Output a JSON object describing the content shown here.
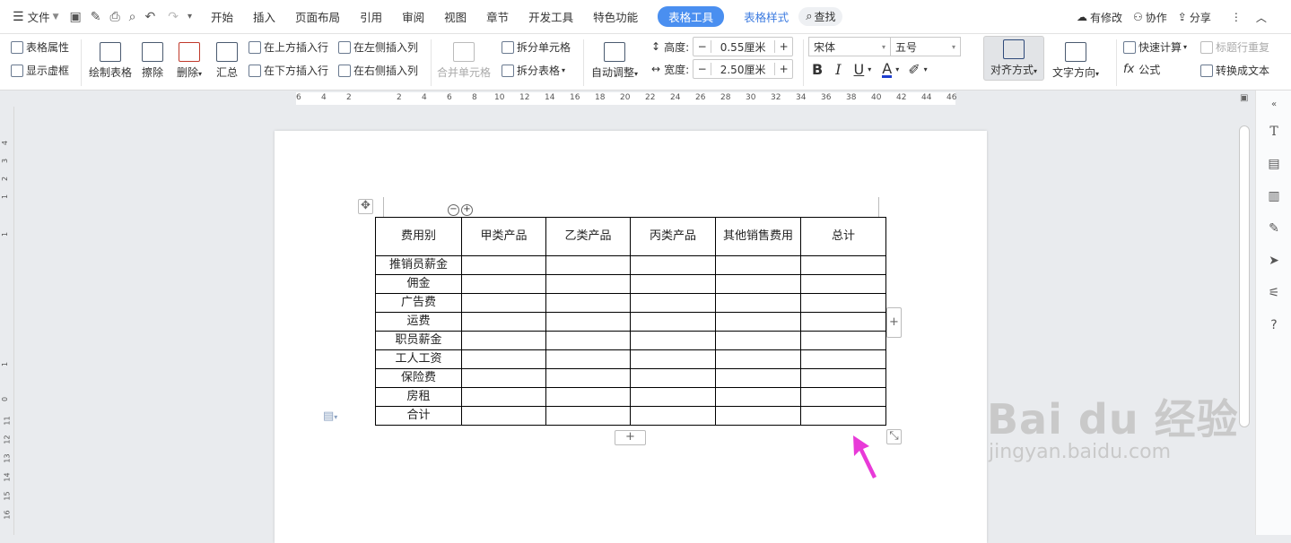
{
  "menubar": {
    "file": "文件",
    "tabs": [
      "开始",
      "插入",
      "页面布局",
      "引用",
      "审阅",
      "视图",
      "章节",
      "开发工具",
      "特色功能"
    ],
    "active_tab": "表格工具",
    "style_tab": "表格样式",
    "search": "查找",
    "has_changes": "有修改",
    "collab": "协作",
    "share": "分享"
  },
  "ribbon": {
    "table_props": "表格属性",
    "show_grid": "显示虚框",
    "draw_table": "绘制表格",
    "erase": "擦除",
    "delete": "删除",
    "summary": "汇总",
    "insert_above": "在上方插入行",
    "insert_below": "在下方插入行",
    "insert_left": "在左侧插入列",
    "insert_right": "在右侧插入列",
    "merge_cells": "合并单元格",
    "split_cells": "拆分单元格",
    "split_table": "拆分表格",
    "auto_adjust": "自动调整",
    "height_label": "高度:",
    "height_value": "0.55厘米",
    "width_label": "宽度:",
    "width_value": "2.50厘米",
    "font_name": "宋体",
    "font_size": "五号",
    "align": "对齐方式",
    "text_dir": "文字方向",
    "quick_calc": "快速计算",
    "formula": "公式",
    "title_repeat": "标题行重复",
    "to_text": "转换成文本"
  },
  "ruler": {
    "marks": [
      "6",
      "4",
      "2",
      "2",
      "4",
      "6",
      "8",
      "10",
      "12",
      "14",
      "16",
      "18",
      "20",
      "22",
      "24",
      "26",
      "28",
      "30",
      "32",
      "34",
      "36",
      "38",
      "40",
      "42",
      "44",
      "46"
    ]
  },
  "vruler": {
    "marks": [
      "4",
      "3",
      "2",
      "1",
      "1",
      "1",
      "0",
      "11",
      "12",
      "13",
      "14",
      "15",
      "16",
      "17"
    ]
  },
  "table": {
    "headers": [
      "费用别",
      "甲类产品",
      "乙类产品",
      "丙类产品",
      "其他销售费用",
      "总计"
    ],
    "rows": [
      "推销员薪金",
      "佣金",
      "广告费",
      "运费",
      "职员薪金",
      "工人工资",
      "保险费",
      "房租",
      "合计"
    ]
  },
  "watermark": {
    "brand": "Bai du 经验",
    "url": "jingyan.baidu.com"
  },
  "colors": {
    "accent": "#4a8ff0",
    "arrow": "#e83ad8",
    "font_color": "#1f3fcf"
  }
}
